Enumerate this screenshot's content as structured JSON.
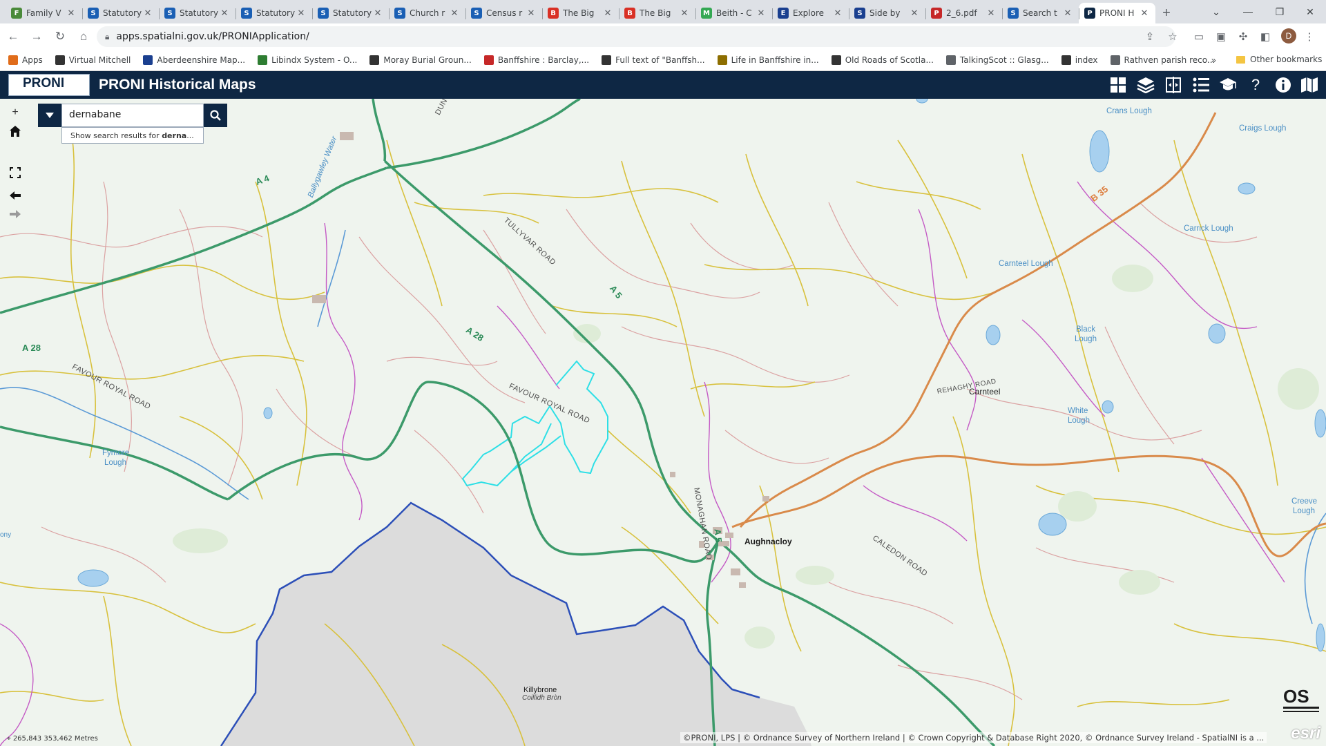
{
  "browser": {
    "tabs": [
      {
        "title": "Family V",
        "color": "#4a8a3a",
        "glyph": "F"
      },
      {
        "title": "Statutory",
        "color": "#1a5fb4",
        "glyph": "S"
      },
      {
        "title": "Statutory",
        "color": "#1a5fb4",
        "glyph": "S"
      },
      {
        "title": "Statutory",
        "color": "#1a5fb4",
        "glyph": "S"
      },
      {
        "title": "Statutory",
        "color": "#1a5fb4",
        "glyph": "S"
      },
      {
        "title": "Church r",
        "color": "#1a5fb4",
        "glyph": "S"
      },
      {
        "title": "Census r",
        "color": "#1a5fb4",
        "glyph": "S"
      },
      {
        "title": "The Big",
        "color": "#d93025",
        "glyph": "B"
      },
      {
        "title": "The Big",
        "color": "#d93025",
        "glyph": "B"
      },
      {
        "title": "Beith - C",
        "color": "#34a853",
        "glyph": "M"
      },
      {
        "title": "Explore",
        "color": "#1a3f8f",
        "glyph": "E"
      },
      {
        "title": "Side by",
        "color": "#1a3f8f",
        "glyph": "S"
      },
      {
        "title": "2_6.pdf",
        "color": "#c62828",
        "glyph": "P"
      },
      {
        "title": "Search t",
        "color": "#1a5fb4",
        "glyph": "S"
      },
      {
        "title": "PRONI H",
        "color": "#0e2744",
        "glyph": "P",
        "active": true
      }
    ],
    "new_tab": "+",
    "url": "apps.spatialni.gov.uk/PRONIApplication/",
    "avatar_letter": "D",
    "bookmarks": [
      {
        "label": "Apps",
        "color": "#e06c1a"
      },
      {
        "label": "Virtual Mitchell",
        "color": "#333333"
      },
      {
        "label": "Aberdeenshire Map...",
        "color": "#1a3f8f"
      },
      {
        "label": "Libindx System - O...",
        "color": "#2e7d32"
      },
      {
        "label": "Moray Burial Groun...",
        "color": "#333333"
      },
      {
        "label": "Banffshire : Barclay,...",
        "color": "#c62828"
      },
      {
        "label": "Full text of \"Banffsh...",
        "color": "#333333"
      },
      {
        "label": "Life in Banffshire in...",
        "color": "#8d6e00"
      },
      {
        "label": "Old Roads of Scotla...",
        "color": "#333333"
      },
      {
        "label": "TalkingScot :: Glasg...",
        "color": "#5f6368"
      },
      {
        "label": "index",
        "color": "#333333"
      },
      {
        "label": "Rathven parish reco...",
        "color": "#5f6368"
      }
    ],
    "bookmarks_overflow": "»",
    "other_bookmarks": "Other bookmarks"
  },
  "app": {
    "logo_text": "PRONI",
    "title": "PRONI Historical Maps",
    "header_icons": [
      "basemap-gallery-icon",
      "layers-icon",
      "compare-icon",
      "legend-icon",
      "education-icon",
      "help-icon",
      "info-icon",
      "map-book-icon"
    ]
  },
  "search": {
    "value": "dernabane",
    "suggestion_prefix": "Show search results for ",
    "suggestion_term": "derna",
    "suggestion_suffix": "..."
  },
  "map": {
    "labels": {
      "aughnacloy": "Aughnacloy",
      "carnteel": "Carnteel",
      "killybrone": "Killybrone",
      "killybrone_irish": "Coillidh Bròn",
      "crans_lough": "Crans Lough",
      "craigs_lough": "Craigs Lough",
      "carrick_lough": "Carrick Lough",
      "carnteel_lough": "Carnteel Lough",
      "black_lough_1": "Black",
      "black_lough_2": "Lough",
      "white_lough_1": "White",
      "white_lough_2": "Lough",
      "fymore_1": "Fymore",
      "fymore_2": "Lough",
      "creeve_1": "Creeve",
      "creeve_2": "Lough",
      "ballygawley_water": "Ballygawley Water",
      "a4": "A 4",
      "a5_north": "A 5",
      "a5_south": "A 5",
      "a28_west": "A 28",
      "a28_mid": "A 28",
      "b35": "B 35",
      "tullyvar_road": "TULLYVAR ROAD",
      "favour_royal_west": "FAVOUR ROYAL ROAD",
      "favour_royal_mid": "FAVOUR ROYAL ROAD",
      "monaghan_road": "MONAGHAN ROAD",
      "caledon_road": "CALEDON ROAD",
      "rehaghy_road": "REHAGHY ROAD",
      "dun": "DUN",
      "ony": "ony"
    },
    "coordinates": "265,843 353,462 Metres",
    "attribution": "©PRONI, LPS | © Ordnance Survey of Northern Ireland | © Crown Copyright & Database Right 2020, © Ordnance Survey Ireland - SpatialNI is a ...",
    "esri": "esri"
  },
  "colors": {
    "header_bg": "#0e2744",
    "map_bg": "#eff4ee",
    "a_road": "#3c9a6a",
    "b_road": "#d97a3c",
    "minor_road": "#d4bf3a",
    "field_boundary": "#d99a9a",
    "county_boundary": "#c85ac8",
    "border": "#2c4fb8",
    "highlight": "#25e0e8",
    "water": "#8ec2e8"
  }
}
